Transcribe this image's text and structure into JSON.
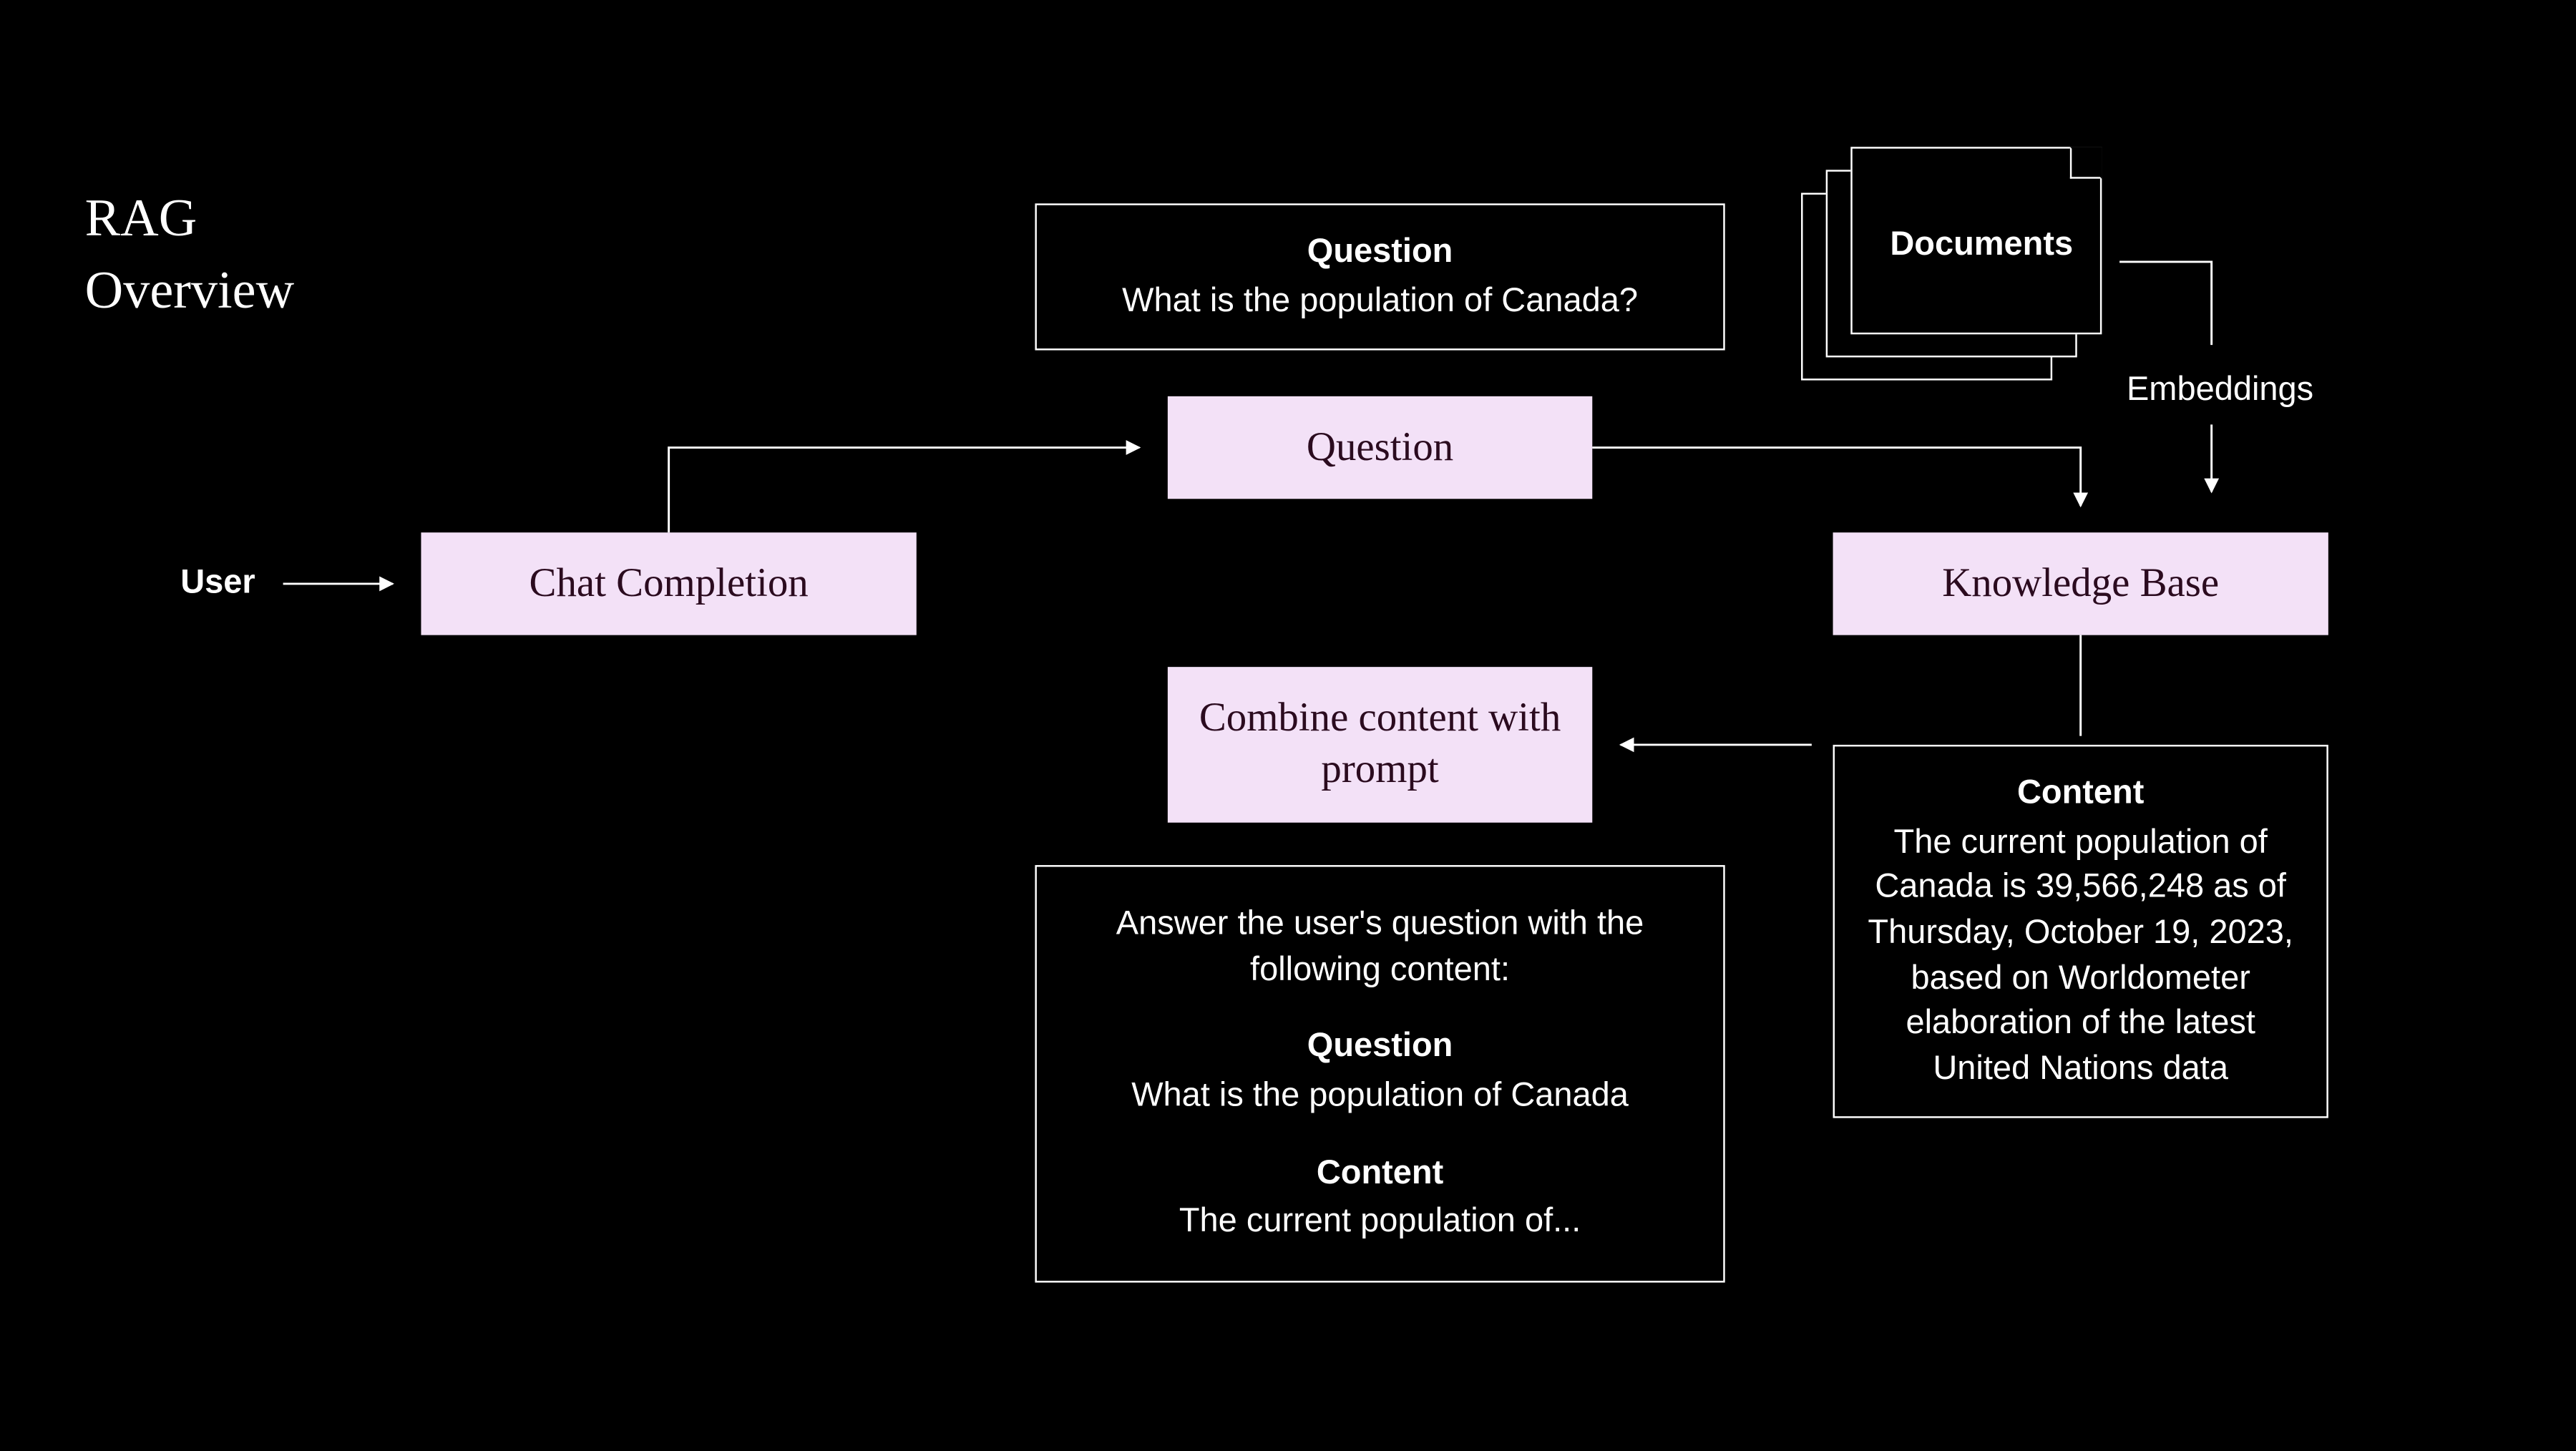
{
  "title_line1": "RAG",
  "title_line2": "Overview",
  "user_label": "User",
  "embeddings_label": "Embeddings",
  "documents_label": "Documents",
  "nodes": {
    "chat_completion": "Chat Completion",
    "question_pink": "Question",
    "combine": "Combine content with prompt",
    "knowledge_base": "Knowledge Base"
  },
  "question_box": {
    "header": "Question",
    "text": "What is the population of Canada?"
  },
  "content_box": {
    "header": "Content",
    "text": "The current population of Canada is 39,566,248 as of Thursday, October 19, 2023, based on Worldometer elaboration of the latest United Nations data"
  },
  "prompt_box": {
    "intro": "Answer the user's question with the following content:",
    "q_header": "Question",
    "q_text": "What is the population of Canada",
    "c_header": "Content",
    "c_text": "The current population of..."
  }
}
